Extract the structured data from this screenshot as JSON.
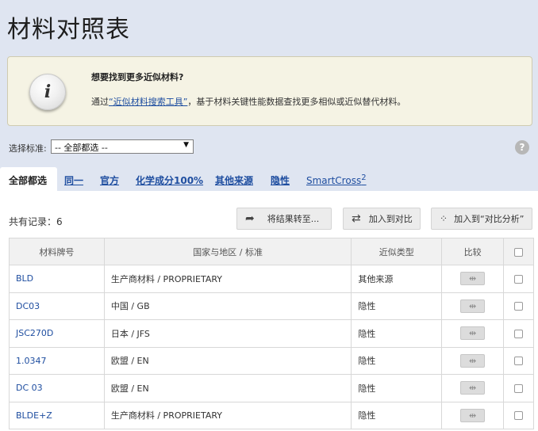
{
  "page": {
    "title": "材料对照表"
  },
  "info": {
    "heading": "想要找到更多近似材料?",
    "text_prefix": "通过",
    "link_text": "“近似材料搜索工具”",
    "text_suffix": "，基于材料关键性能数据查找更多相似或近似替代材料。",
    "icon": "info-icon"
  },
  "filter": {
    "label": "选择标准:",
    "selected": "-- 全部都选 --",
    "help_icon": "question-icon"
  },
  "tabs": [
    {
      "label": "全部都选"
    },
    {
      "label": "同一"
    },
    {
      "label": "官方"
    },
    {
      "label": "化学成分100%"
    },
    {
      "label": "其他来源"
    },
    {
      "label": "隐性"
    },
    {
      "label": "SmartCross",
      "sup": "2"
    }
  ],
  "toolbar": {
    "count_text": "共有记录：6",
    "transfer_label": "将结果转至...",
    "add_compare_label": "加入到对比",
    "add_analysis_label": "加入到“对比分析”"
  },
  "table": {
    "headers": [
      "材料牌号",
      "国家与地区 / 标准",
      "近似类型",
      "比较"
    ],
    "rows": [
      {
        "grade": "BLD",
        "country": "生产商材料 / PROPRIETARY",
        "type": "其他来源"
      },
      {
        "grade": "DC03",
        "country": "中国 / GB",
        "type": "隐性"
      },
      {
        "grade": "JSC270D",
        "country": "日本 / JFS",
        "type": "隐性"
      },
      {
        "grade": "1.0347",
        "country": "欧盟 / EN",
        "type": "隐性"
      },
      {
        "grade": "DC 03",
        "country": "欧盟 / EN",
        "type": "隐性"
      },
      {
        "grade": "BLDE+Z",
        "country": "生产商材料 / PROPRIETARY",
        "type": "隐性"
      }
    ]
  },
  "colors": {
    "header_band": "#dfe5f1",
    "link": "#1f4ea0",
    "info_bg": "#f5f3e4"
  }
}
